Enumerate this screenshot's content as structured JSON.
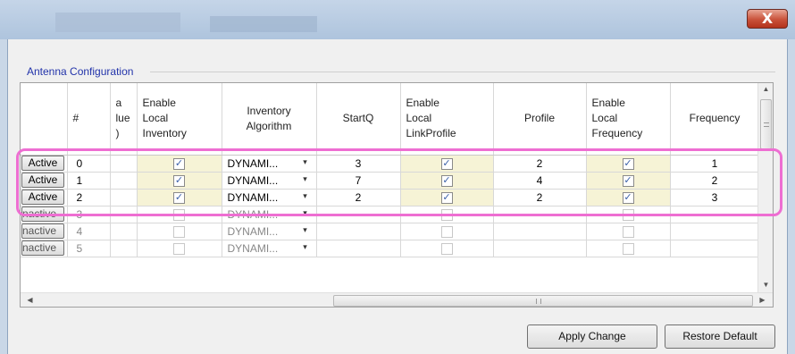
{
  "window": {
    "close_label": "X"
  },
  "group": {
    "title": "Antenna Configuration"
  },
  "grid": {
    "columns": [
      {
        "label": ""
      },
      {
        "label": "#"
      },
      {
        "label": "a\nlue\n)"
      },
      {
        "label": "Enable\nLocal\nInventory"
      },
      {
        "label": "Inventory\nAlgorithm"
      },
      {
        "label": "StartQ"
      },
      {
        "label": "Enable\nLocal\nLinkProfile"
      },
      {
        "label": "Profile"
      },
      {
        "label": "Enable\nLocal\nFrequency"
      },
      {
        "label": "Frequency"
      }
    ],
    "rows": [
      {
        "button": "Active",
        "num": "0",
        "inv_checked": true,
        "algo": "DYNAMI...",
        "startq": "3",
        "lp_checked": true,
        "profile": "2",
        "freq_checked": true,
        "freq": "1",
        "active": true
      },
      {
        "button": "Active",
        "num": "1",
        "inv_checked": true,
        "algo": "DYNAMI...",
        "startq": "7",
        "lp_checked": true,
        "profile": "4",
        "freq_checked": true,
        "freq": "2",
        "active": true
      },
      {
        "button": "Active",
        "num": "2",
        "inv_checked": true,
        "algo": "DYNAMI...",
        "startq": "2",
        "lp_checked": true,
        "profile": "2",
        "freq_checked": true,
        "freq": "3",
        "active": true
      },
      {
        "button": "nactive",
        "num": "3",
        "inv_checked": false,
        "algo": "DYNAMI...",
        "startq": "",
        "lp_checked": false,
        "profile": "",
        "freq_checked": false,
        "freq": "",
        "active": false
      },
      {
        "button": "nactive",
        "num": "4",
        "inv_checked": false,
        "algo": "DYNAMI...",
        "startq": "",
        "lp_checked": false,
        "profile": "",
        "freq_checked": false,
        "freq": "",
        "active": false
      },
      {
        "button": "nactive",
        "num": "5",
        "inv_checked": false,
        "algo": "DYNAMI...",
        "startq": "",
        "lp_checked": false,
        "profile": "",
        "freq_checked": false,
        "freq": "",
        "active": false
      }
    ]
  },
  "buttons": {
    "apply": "Apply Change",
    "restore": "Restore Default"
  },
  "icons": {
    "check": "checkmark-icon",
    "combo": "dropdown-arrow-icon",
    "close": "close-icon"
  },
  "colors": {
    "highlight": "#ee6ed2",
    "group_title": "#2233aa",
    "checkbox_cell": "#f6f3d6"
  }
}
